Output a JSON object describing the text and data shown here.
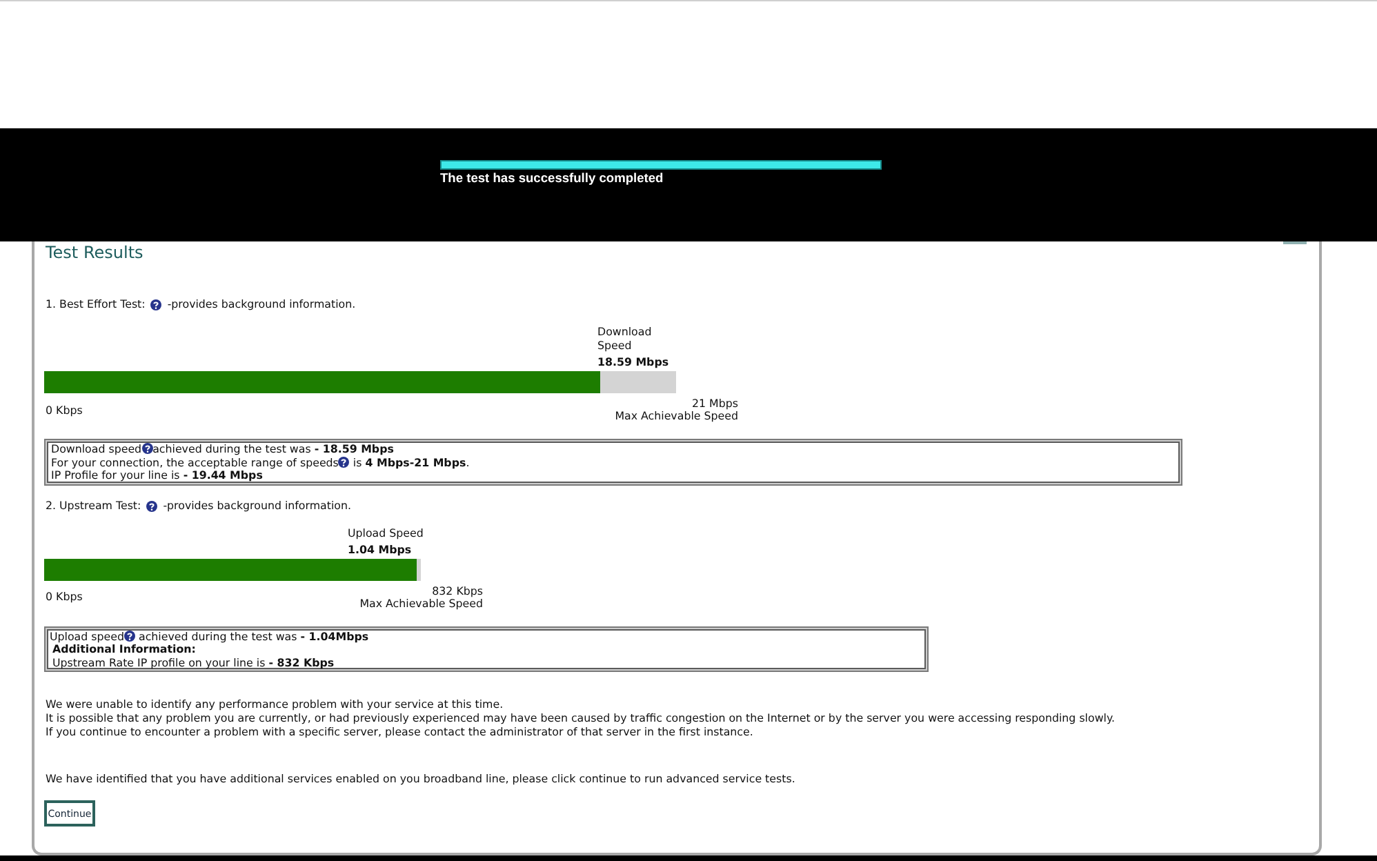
{
  "overlay": {
    "progress": {
      "level": 1
    },
    "status": "The test has successfully completed"
  },
  "panel": {
    "title": "Test Results"
  },
  "tests": [
    {
      "kind": "download",
      "label": "1. Best Effort Test:",
      "note": "-provides background information.",
      "gauge": {
        "caption_lines": [
          "Download",
          "Speed"
        ],
        "value": "18.59 Mbps",
        "level": 0.88,
        "min_label": "0 Kbps",
        "max_label": "21 Mbps",
        "max_caption": "Max Achievable Speed"
      },
      "summary": [
        {
          "kind": "help",
          "before": "Download speed",
          "after": "achieved during the test was **- 18.59 Mbps**"
        },
        {
          "kind": "help",
          "before": "For your connection, the acceptable range of speeds",
          "after": " is **4 Mbps-21 Mbps**."
        },
        {
          "kind": "plain",
          "text": "IP Profile for your line is **- 19.44 Mbps**"
        }
      ]
    },
    {
      "kind": "upload",
      "label": "2. Upstream Test:",
      "note": "-provides background information.",
      "gauge": {
        "caption_lines": [
          "Upload Speed"
        ],
        "value": "1.04 Mbps",
        "level": 0.99,
        "min_label": "0 Kbps",
        "max_label": "832 Kbps",
        "max_caption": "Max Achievable Speed"
      },
      "summary": [
        {
          "kind": "help",
          "before": "Upload speed",
          "after": " achieved during the test was **- 1.04Mbps**"
        },
        {
          "kind": "heading",
          "text": "Additional Information:"
        },
        {
          "kind": "plain",
          "text": "Upstream Rate IP profile on your line is **- 832 Kbps**"
        }
      ]
    }
  ],
  "messages": [
    "We were unable to identify any performance problem with your service at this time.",
    "It is possible that any problem you are currently, or had previously experienced may have been caused by traffic congestion on the Internet or by the server you were accessing responding slowly.",
    "If you continue to encounter a problem with a specific server, please contact the administrator of that server in the first instance."
  ],
  "advice": "We have identified that you have additional services enabled on you broadband line, please click continue to run advanced service tests.",
  "buttons": [
    {
      "label": "Continue"
    }
  ]
}
